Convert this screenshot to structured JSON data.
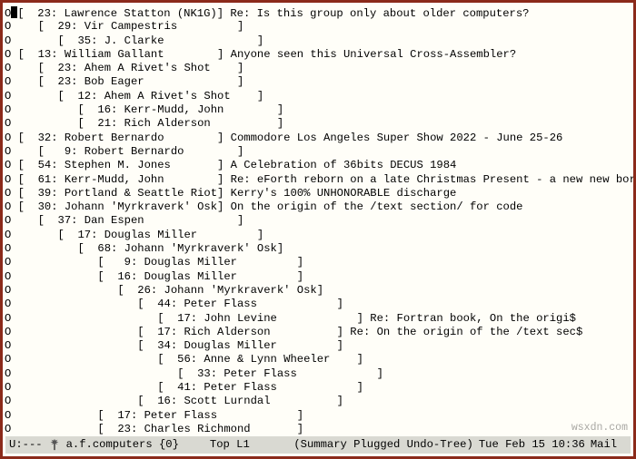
{
  "threads": [
    {
      "indent": 0,
      "marker": "O",
      "num": "23",
      "author": "Lawrence Statton (NK1G)",
      "subject": "Re: Is this group only about older computers?"
    },
    {
      "indent": 1,
      "marker": "O",
      "num": "29",
      "author": "Vir Campestris",
      "subject": ""
    },
    {
      "indent": 2,
      "marker": "O",
      "num": "35",
      "author": "J. Clarke",
      "subject": ""
    },
    {
      "indent": 0,
      "marker": "O",
      "num": "13",
      "author": "William Gallant",
      "subject": "Anyone seen this Universal Cross-Assembler?"
    },
    {
      "indent": 1,
      "marker": "O",
      "num": "23",
      "author": "Ahem A Rivet's Shot",
      "subject": ""
    },
    {
      "indent": 1,
      "marker": "O",
      "num": "23",
      "author": "Bob Eager",
      "subject": ""
    },
    {
      "indent": 2,
      "marker": "O",
      "num": "12",
      "author": "Ahem A Rivet's Shot",
      "subject": ""
    },
    {
      "indent": 3,
      "marker": "O",
      "num": "16",
      "author": "Kerr-Mudd, John",
      "subject": ""
    },
    {
      "indent": 3,
      "marker": "O",
      "num": "21",
      "author": "Rich Alderson",
      "subject": ""
    },
    {
      "indent": 0,
      "marker": "O",
      "num": "32",
      "author": "Robert Bernardo",
      "subject": "Commodore Los Angeles Super Show 2022 - June 25-26"
    },
    {
      "indent": 1,
      "marker": "O",
      "num": "9",
      "author": "Robert Bernardo",
      "subject": ""
    },
    {
      "indent": 0,
      "marker": "O",
      "num": "54",
      "author": "Stephen M. Jones",
      "subject": "A Celebration of 36bits DECUS 1984"
    },
    {
      "indent": 0,
      "marker": "O",
      "num": "61",
      "author": "Kerr-Mudd, John",
      "subject": "Re: eForth reborn on a late Christmas Present - a new new born$"
    },
    {
      "indent": 0,
      "marker": "O",
      "num": "39",
      "author": "Portland & Seattle Riot",
      "subject": "Kerry's 100% UNHONORABLE discharge"
    },
    {
      "indent": 0,
      "marker": "O",
      "num": "30",
      "author": "Johann 'Myrkraverk' Osk",
      "subject": "On the origin of the /text section/ for code"
    },
    {
      "indent": 1,
      "marker": "O",
      "num": "37",
      "author": "Dan Espen",
      "subject": ""
    },
    {
      "indent": 2,
      "marker": "O",
      "num": "17",
      "author": "Douglas Miller",
      "subject": ""
    },
    {
      "indent": 3,
      "marker": "O",
      "num": "68",
      "author": "Johann 'Myrkraverk' Osk",
      "subject": ""
    },
    {
      "indent": 4,
      "marker": "O",
      "num": "9",
      "author": "Douglas Miller",
      "subject": ""
    },
    {
      "indent": 4,
      "marker": "O",
      "num": "16",
      "author": "Douglas Miller",
      "subject": ""
    },
    {
      "indent": 5,
      "marker": "O",
      "num": "26",
      "author": "Johann 'Myrkraverk' Osk",
      "subject": ""
    },
    {
      "indent": 6,
      "marker": "O",
      "num": "44",
      "author": "Peter Flass",
      "subject": ""
    },
    {
      "indent": 7,
      "marker": "O",
      "num": "17",
      "author": "John Levine",
      "subject": "Re: Fortran book, On the origi$"
    },
    {
      "indent": 6,
      "marker": "O",
      "num": "17",
      "author": "Rich Alderson",
      "subject": "Re: On the origin of the /text sec$"
    },
    {
      "indent": 6,
      "marker": "O",
      "num": "34",
      "author": "Douglas Miller",
      "subject": ""
    },
    {
      "indent": 7,
      "marker": "O",
      "num": "56",
      "author": "Anne & Lynn Wheeler",
      "subject": ""
    },
    {
      "indent": 8,
      "marker": "O",
      "num": "33",
      "author": "Peter Flass",
      "subject": ""
    },
    {
      "indent": 7,
      "marker": "O",
      "num": "41",
      "author": "Peter Flass",
      "subject": ""
    },
    {
      "indent": 6,
      "marker": "O",
      "num": "16",
      "author": "Scott Lurndal",
      "subject": ""
    },
    {
      "indent": 4,
      "marker": "O",
      "num": "17",
      "author": "Peter Flass",
      "subject": ""
    },
    {
      "indent": 4,
      "marker": "O",
      "num": "23",
      "author": "Charles Richmond",
      "subject": ""
    }
  ],
  "author_width": 23,
  "modeline": {
    "left": "U:---",
    "buffer": "a.f.computers {0}",
    "pos": "Top L1",
    "modes": "(Summary Plugged Undo-Tree)",
    "date": "Tue Feb 15 10:36",
    "tail": "Mail"
  },
  "watermark": "wsxdn.com"
}
